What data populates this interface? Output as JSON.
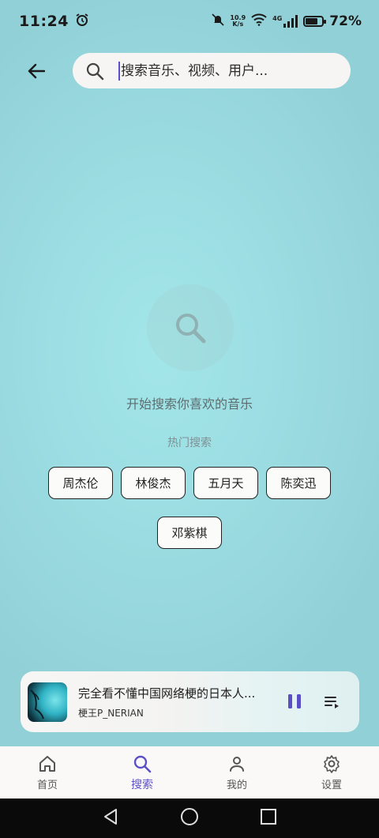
{
  "status_bar": {
    "time": "11:24",
    "net_speed_value": "10.9",
    "net_speed_unit": "K/s",
    "network_type": "4G",
    "battery_percent": "72%",
    "battery_level": 0.72
  },
  "search": {
    "placeholder": "搜索音乐、视频、用户..."
  },
  "empty_state": {
    "message": "开始搜索你喜欢的音乐",
    "hot_label": "热门搜索",
    "hot_searches": [
      "周杰伦",
      "林俊杰",
      "五月天",
      "陈奕迅",
      "邓紫棋"
    ]
  },
  "mini_player": {
    "title": "完全看不懂中国网络梗的日本人...",
    "artist": "梗王P_NERIAN",
    "state": "playing"
  },
  "bottom_nav": {
    "items": [
      {
        "label": "首页",
        "icon": "home-icon"
      },
      {
        "label": "搜索",
        "icon": "search-icon",
        "active": true
      },
      {
        "label": "我的",
        "icon": "person-icon"
      },
      {
        "label": "设置",
        "icon": "gear-icon"
      }
    ]
  },
  "colors": {
    "accent": "#5b4fc7",
    "background": "#9bdde2"
  }
}
